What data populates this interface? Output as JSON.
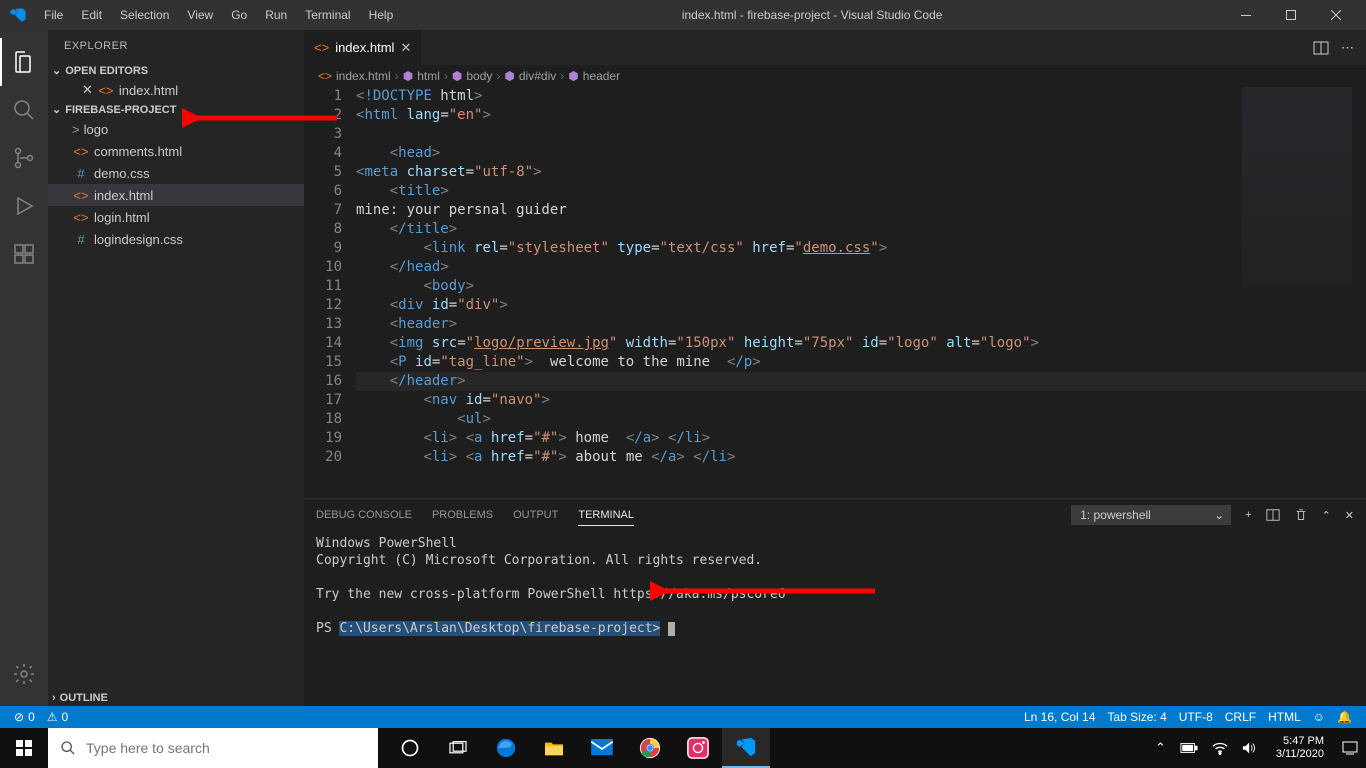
{
  "window": {
    "title": "index.html - firebase-project - Visual Studio Code"
  },
  "menu": [
    "File",
    "Edit",
    "Selection",
    "View",
    "Go",
    "Run",
    "Terminal",
    "Help"
  ],
  "sidebar": {
    "title": "EXPLORER",
    "sections": {
      "openEditors": "OPEN EDITORS",
      "project": "FIREBASE-PROJECT",
      "outline": "OUTLINE"
    },
    "openFiles": [
      {
        "name": "index.html",
        "icon": "<>"
      }
    ],
    "tree": [
      {
        "name": "logo",
        "type": "folder",
        "chev": ">"
      },
      {
        "name": "comments.html",
        "type": "html"
      },
      {
        "name": "demo.css",
        "type": "css"
      },
      {
        "name": "index.html",
        "type": "html",
        "selected": true
      },
      {
        "name": "login.html",
        "type": "html"
      },
      {
        "name": "logindesign.css",
        "type": "css"
      }
    ]
  },
  "tabs": {
    "active": {
      "name": "index.html"
    }
  },
  "breadcrumb": [
    "index.html",
    "html",
    "body",
    "div#div",
    "header"
  ],
  "code": {
    "lines": [
      "<!DOCTYPE html>",
      "<html lang=\"en\">",
      "",
      "    <head>",
      "<meta charset=\"utf-8\">",
      "    <title>",
      "mine: your persnal guider",
      "    </title>",
      "        <link rel=\"stylesheet\" type=\"text/css\" href=\"demo.css\">",
      "    </head>",
      "        <body>",
      "    <div id=\"div\">",
      "    <header>",
      "    <img src=\"logo/preview.jpg\" width=\"150px\" height=\"75px\" id=\"logo\" alt=\"logo\">",
      "    <P id=\"tag_line\">  welcome to the mine  </p>",
      "    </header>",
      "        <nav id=\"navo\">",
      "            <ul>",
      "        <li> <a href=\"#\"> home  </a> </li>",
      "        <li> <a href=\"#\"> about me </a> </li>"
    ],
    "startLine": 1
  },
  "panel": {
    "tabs": [
      "DEBUG CONSOLE",
      "PROBLEMS",
      "OUTPUT",
      "TERMINAL"
    ],
    "activeTab": "TERMINAL",
    "terminalSelect": "1: powershell",
    "terminal": {
      "line1": "Windows PowerShell",
      "line2": "Copyright (C) Microsoft Corporation. All rights reserved.",
      "line3": "Try the new cross-platform PowerShell https://aka.ms/pscore6",
      "promptPrefix": "PS ",
      "promptPath": "C:\\Users\\Arslan\\Desktop\\firebase-project>"
    }
  },
  "statusbar": {
    "errors": "0",
    "warnings": "0",
    "lncol": "Ln 16, Col 14",
    "tabsize": "Tab Size: 4",
    "encoding": "UTF-8",
    "eol": "CRLF",
    "lang": "HTML"
  },
  "taskbar": {
    "searchPlaceholder": "Type here to search",
    "time": "5:47 PM",
    "date": "3/11/2020"
  }
}
